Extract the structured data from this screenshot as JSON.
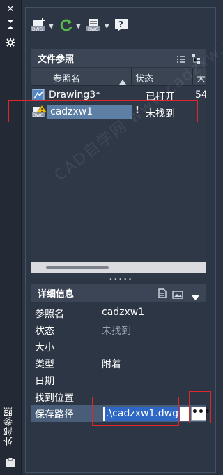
{
  "palette": {
    "title": "外部参照",
    "controls": {
      "close": "✕",
      "autohide": "⇵",
      "settings": "✱"
    }
  },
  "toolbar": {
    "items": [
      {
        "icon": "attach-dwg-icon"
      },
      {
        "icon": "refresh-icon"
      },
      {
        "icon": "change-path-icon"
      },
      {
        "icon": "help-icon"
      }
    ]
  },
  "file_references": {
    "title": "文件参照",
    "columns": {
      "name": "参照名",
      "status": "状态",
      "size": "大"
    },
    "rows": [
      {
        "name": "Drawing3*",
        "status": "已打开",
        "size": "54",
        "icon": "drawing-master-icon",
        "warn": ""
      },
      {
        "name": "cadzxw1",
        "status": "未找到",
        "size": "",
        "icon": "dwg-warning-icon",
        "warn": "!"
      }
    ],
    "grip": "•••••"
  },
  "details": {
    "title": "详细信息",
    "fields": [
      {
        "key": "参照名",
        "value": "cadzxw1"
      },
      {
        "key": "状态",
        "value": "未找到"
      },
      {
        "key": "大小",
        "value": ""
      },
      {
        "key": "类型",
        "value": "附着"
      },
      {
        "key": "日期",
        "value": ""
      },
      {
        "key": "找到位置",
        "value": ""
      }
    ],
    "save_path_label": "保存路径",
    "save_path_value": ".\\cadzxw1.dwg",
    "browse_label": "•••"
  },
  "watermark": "CAD自学网 www.cadzxw.com",
  "colors": {
    "highlight": "#e0262b",
    "selection": "#5d7fa6",
    "path_select": "#2f67c4"
  }
}
